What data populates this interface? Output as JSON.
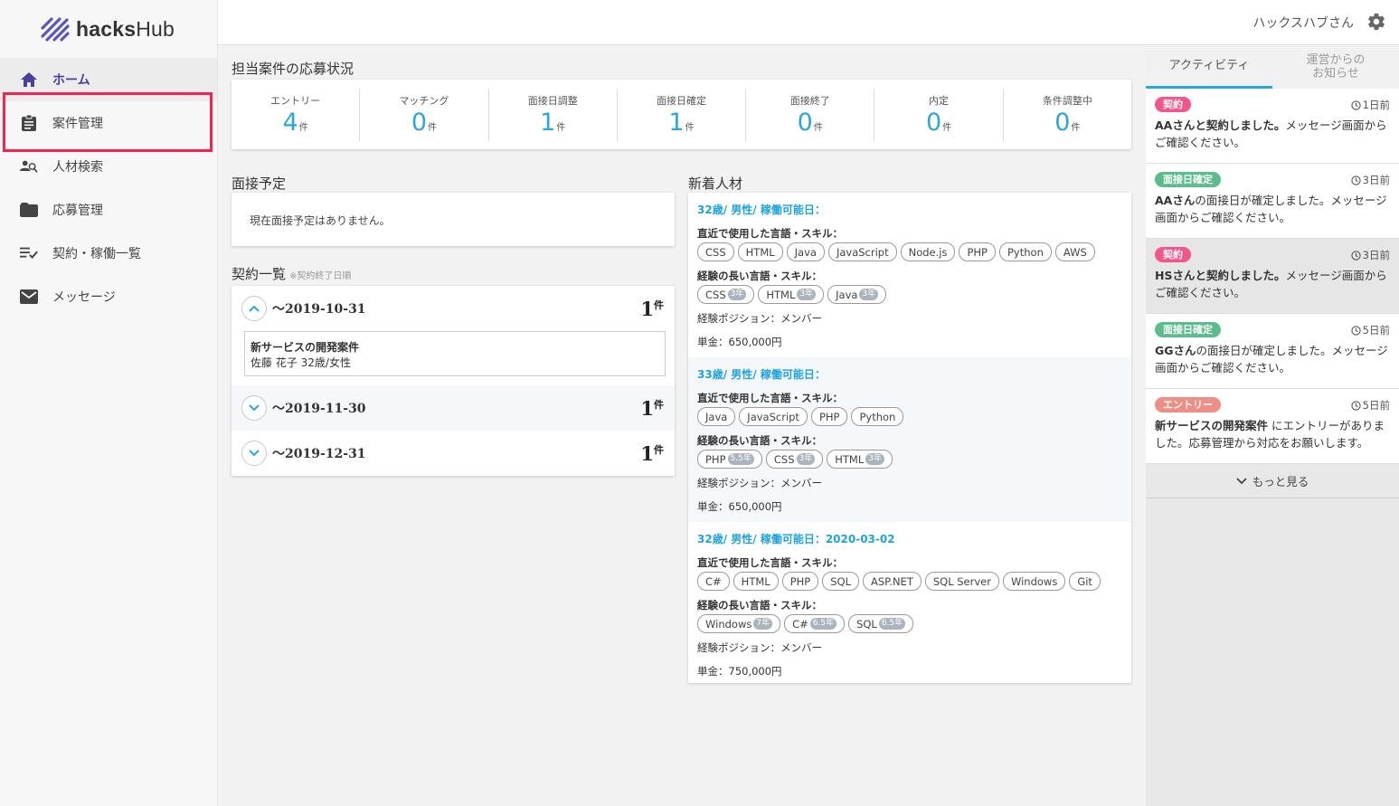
{
  "app": {
    "logo_text_bold": "hacks",
    "logo_text_regular": "Hub"
  },
  "user": {
    "name": "ハックスハブさん"
  },
  "nav": [
    {
      "label": "ホーム",
      "icon": "home-icon"
    },
    {
      "label": "案件管理",
      "icon": "clipboard-icon"
    },
    {
      "label": "人材検索",
      "icon": "person-search-icon"
    },
    {
      "label": "応募管理",
      "icon": "folder-icon"
    },
    {
      "label": "契約・稼働一覧",
      "icon": "checklist-icon"
    },
    {
      "label": "メッセージ",
      "icon": "mail-icon"
    }
  ],
  "status": {
    "title": "担当案件の応募状況",
    "unit": "件",
    "items": [
      {
        "label": "エントリー",
        "value": "4"
      },
      {
        "label": "マッチング",
        "value": "0"
      },
      {
        "label": "面接日調整",
        "value": "1"
      },
      {
        "label": "面接日確定",
        "value": "1"
      },
      {
        "label": "面接終了",
        "value": "0"
      },
      {
        "label": "内定",
        "value": "0"
      },
      {
        "label": "条件調整中",
        "value": "0"
      }
    ]
  },
  "interview": {
    "title": "面接予定",
    "empty_text": "現在面接予定はありません。"
  },
  "contracts": {
    "title": "契約一覧",
    "note": "※契約終了日順",
    "unit": "件",
    "groups": [
      {
        "date": "〜2019-10-31",
        "count": "1",
        "expanded": true,
        "project": "新サービスの開発案件",
        "person": "佐藤 花子 32歳/女性"
      },
      {
        "date": "〜2019-11-30",
        "count": "1",
        "expanded": false
      },
      {
        "date": "〜2019-12-31",
        "count": "1",
        "expanded": false
      }
    ]
  },
  "talents": {
    "title": "新着人材",
    "recent_label": "直近で使用した言語・スキル：",
    "long_label": "経験の長い言語・スキル：",
    "items": [
      {
        "head": "32歳/ 男性/ 稼働可能日：",
        "recent": [
          "CSS",
          "HTML",
          "Java",
          "JavaScript",
          "Node.js",
          "PHP",
          "Python",
          "AWS"
        ],
        "long": [
          {
            "name": "CSS",
            "years": "3年"
          },
          {
            "name": "HTML",
            "years": "3年"
          },
          {
            "name": "Java",
            "years": "3年"
          }
        ],
        "position": "経験ポジション：メンバー",
        "price": "単金：650,000円"
      },
      {
        "head": "33歳/ 男性/ 稼働可能日：",
        "recent": [
          "Java",
          "JavaScript",
          "PHP",
          "Python"
        ],
        "long": [
          {
            "name": "PHP",
            "years": "5.5年"
          },
          {
            "name": "CSS",
            "years": "3年"
          },
          {
            "name": "HTML",
            "years": "3年"
          }
        ],
        "position": "経験ポジション：メンバー",
        "price": "単金：650,000円"
      },
      {
        "head": "32歳/ 男性/ 稼働可能日：2020-03-02",
        "recent": [
          "C#",
          "HTML",
          "PHP",
          "SQL",
          "ASP.NET",
          "SQL Server",
          "Windows",
          "Git"
        ],
        "long": [
          {
            "name": "Windows",
            "years": "7年"
          },
          {
            "name": "C#",
            "years": "6.5年"
          },
          {
            "name": "SQL",
            "years": "6.5年"
          }
        ],
        "position": "経験ポジション：メンバー",
        "price": "単金：750,000円"
      }
    ]
  },
  "right_panel": {
    "tabs": [
      "アクティビティ",
      "運営からの\nお知らせ"
    ],
    "more_label": "もっと見る",
    "activities": [
      {
        "badge": "契約",
        "badge_color": "#f2568b",
        "time": "1日前",
        "text_bold": "AAさんと契約しました。",
        "text": "メッセージ画面からご確認ください。"
      },
      {
        "badge": "面接日確定",
        "badge_color": "#5bbd8c",
        "time": "3日前",
        "text_bold": "AAさん",
        "text": "の面接日が確定しました。メッセージ画面からご確認ください。"
      },
      {
        "badge": "契約",
        "badge_color": "#f2568b",
        "time": "3日前",
        "text_bold": "HSさんと契約しました。",
        "text": "メッセージ画面からご確認ください。"
      },
      {
        "badge": "面接日確定",
        "badge_color": "#5bbd8c",
        "time": "5日前",
        "text_bold": "GGさん",
        "text": "の面接日が確定しました。メッセージ画面からご確認ください。"
      },
      {
        "badge": "エントリー",
        "badge_color": "#ef8e86",
        "time": "5日前",
        "text_bold": "新サービスの開発案件",
        "text": " にエントリーがありました。応募管理から対応をお願いします。"
      }
    ]
  }
}
